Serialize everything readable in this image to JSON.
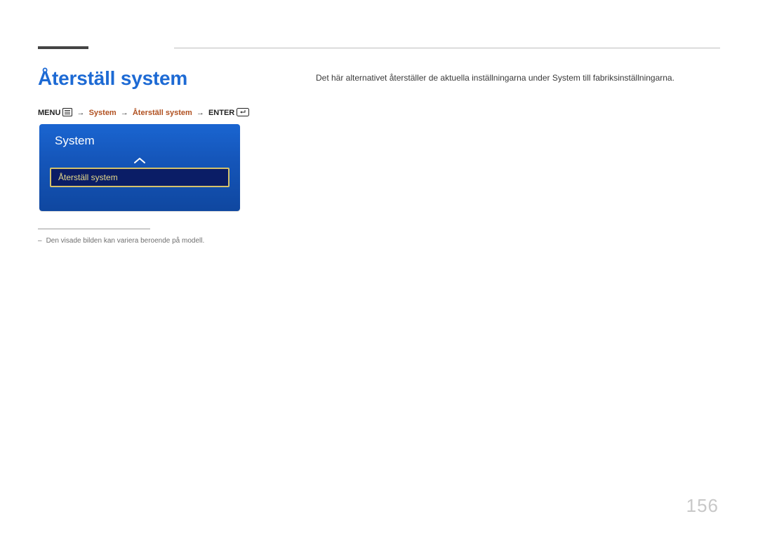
{
  "heading": "Återställ system",
  "description": "Det här alternativet återställer de aktuella inställningarna under System till fabriksinställningarna.",
  "breadcrumb": {
    "menu_label": "MENU",
    "system_label": "System",
    "reset_label": "Återställ system",
    "enter_label": "ENTER",
    "arrow_glyph": "→"
  },
  "panel": {
    "title": "System",
    "selected_item": "Återställ system"
  },
  "note": {
    "dash": "–",
    "text": "Den visade bilden kan variera beroende på modell."
  },
  "page_number": "156"
}
